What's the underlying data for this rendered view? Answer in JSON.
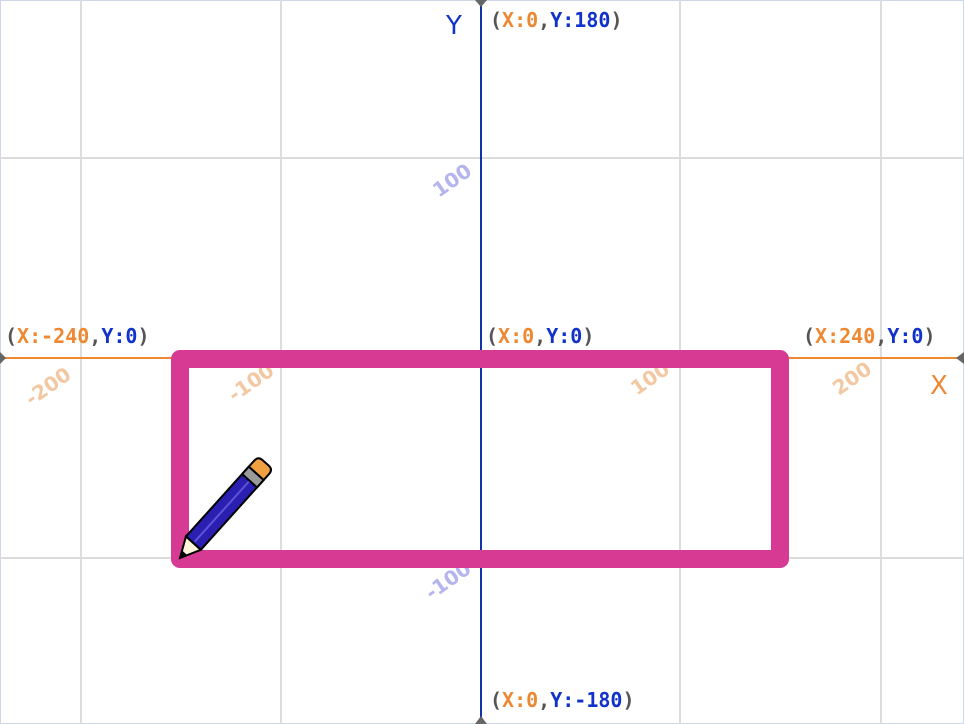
{
  "stage": {
    "colors": {
      "grid": "#dcdcdc",
      "x_axis": "#ee8833",
      "y_axis": "#1133aa",
      "pen": "#d63a92",
      "pencil_body": "#2a1fb0",
      "pencil_eraser": "#f0a040"
    },
    "axes": {
      "x_name": "X",
      "y_name": "Y"
    },
    "coord_labels": {
      "top": {
        "open": "(",
        "x": "X:0",
        "comma": ",",
        "y": "Y:180",
        "close": ")"
      },
      "bottom": {
        "open": "(",
        "x": "X:0",
        "comma": ",",
        "y": "Y:-180",
        "close": ")"
      },
      "left": {
        "open": "(",
        "x": "X:-240",
        "comma": ",",
        "y": "Y:0",
        "close": ")"
      },
      "right": {
        "open": "(",
        "x": "X:240",
        "comma": ",",
        "y": "Y:0",
        "close": ")"
      },
      "origin": {
        "open": "(",
        "x": "X:0",
        "comma": ",",
        "y": "Y:0",
        "close": ")"
      }
    },
    "tick_labels": {
      "x_neg_200": "-200",
      "x_neg_100": "-100",
      "x_pos_100": "100",
      "x_pos_200": "200",
      "y_pos_100": "100",
      "y_neg_100": "-100"
    },
    "sprite": {
      "name": "pencil-icon"
    }
  }
}
